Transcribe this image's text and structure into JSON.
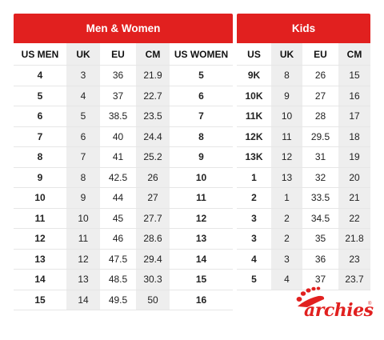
{
  "men_women": {
    "title": "Men & Women",
    "headers": [
      "US MEN",
      "UK",
      "EU",
      "CM",
      "US WOMEN"
    ],
    "rows": [
      [
        "4",
        "3",
        "36",
        "21.9",
        "5"
      ],
      [
        "5",
        "4",
        "37",
        "22.7",
        "6"
      ],
      [
        "6",
        "5",
        "38.5",
        "23.5",
        "7"
      ],
      [
        "7",
        "6",
        "40",
        "24.4",
        "8"
      ],
      [
        "8",
        "7",
        "41",
        "25.2",
        "9"
      ],
      [
        "9",
        "8",
        "42.5",
        "26",
        "10"
      ],
      [
        "10",
        "9",
        "44",
        "27",
        "11"
      ],
      [
        "11",
        "10",
        "45",
        "27.7",
        "12"
      ],
      [
        "12",
        "11",
        "46",
        "28.6",
        "13"
      ],
      [
        "13",
        "12",
        "47.5",
        "29.4",
        "14"
      ],
      [
        "14",
        "13",
        "48.5",
        "30.3",
        "15"
      ],
      [
        "15",
        "14",
        "49.5",
        "50",
        "16"
      ]
    ]
  },
  "kids": {
    "title": "Kids",
    "headers": [
      "US",
      "UK",
      "EU",
      "CM"
    ],
    "rows": [
      [
        "9K",
        "8",
        "26",
        "15"
      ],
      [
        "10K",
        "9",
        "27",
        "16"
      ],
      [
        "11K",
        "10",
        "28",
        "17"
      ],
      [
        "12K",
        "11",
        "29.5",
        "18"
      ],
      [
        "13K",
        "12",
        "31",
        "19"
      ],
      [
        "1",
        "13",
        "32",
        "20"
      ],
      [
        "2",
        "1",
        "33.5",
        "21"
      ],
      [
        "3",
        "2",
        "34.5",
        "22"
      ],
      [
        "3",
        "2",
        "35",
        "21.8"
      ],
      [
        "4",
        "3",
        "36",
        "23"
      ],
      [
        "5",
        "4",
        "37",
        "23.7"
      ]
    ]
  },
  "brand": {
    "name": "archies",
    "registered": "®",
    "color": "#e1201f",
    "icon": "footprint-icon"
  }
}
